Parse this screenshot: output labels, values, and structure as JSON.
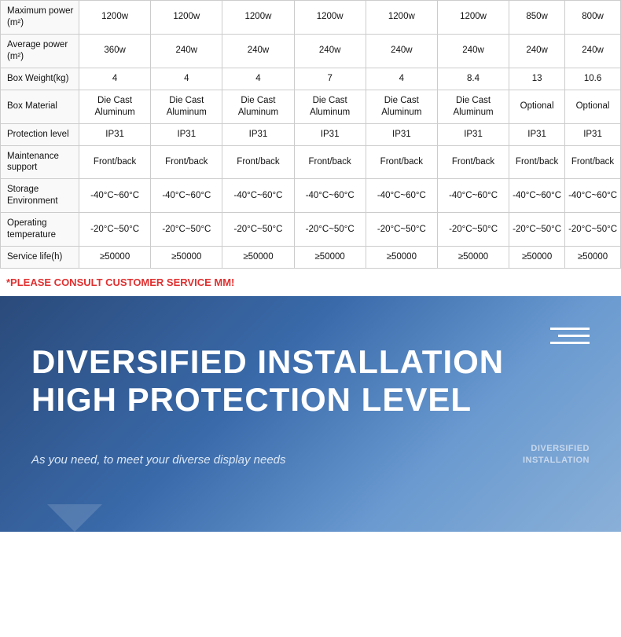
{
  "table": {
    "rows": [
      {
        "label": "Maximum power (m²)",
        "cols": [
          "1200w",
          "1200w",
          "1200w",
          "1200w",
          "1200w",
          "1200w",
          "850w",
          "800w"
        ]
      },
      {
        "label": "Average power (m²)",
        "cols": [
          "360w",
          "240w",
          "240w",
          "240w",
          "240w",
          "240w",
          "240w",
          "240w"
        ]
      },
      {
        "label": "Box Weight(kg)",
        "cols": [
          "4",
          "4",
          "4",
          "7",
          "4",
          "8.4",
          "13",
          "10.6"
        ]
      },
      {
        "label": "Box Material",
        "cols": [
          "Die Cast Aluminum",
          "Die Cast Aluminum",
          "Die Cast Aluminum",
          "Die Cast Aluminum",
          "Die Cast Aluminum",
          "Die Cast Aluminum",
          "Optional",
          "Optional"
        ]
      },
      {
        "label": "Protection level",
        "cols": [
          "IP31",
          "IP31",
          "IP31",
          "IP31",
          "IP31",
          "IP31",
          "IP31",
          "IP31"
        ]
      },
      {
        "label": "Maintenance support",
        "cols": [
          "Front/back",
          "Front/back",
          "Front/back",
          "Front/back",
          "Front/back",
          "Front/back",
          "Front/back",
          "Front/back"
        ]
      },
      {
        "label": "Storage Environment",
        "cols": [
          "-40°C~60°C",
          "-40°C~60°C",
          "-40°C~60°C",
          "-40°C~60°C",
          "-40°C~60°C",
          "-40°C~60°C",
          "-40°C~60°C",
          "-40°C~60°C"
        ]
      },
      {
        "label": "Operating temperature",
        "cols": [
          "-20°C~50°C",
          "-20°C~50°C",
          "-20°C~50°C",
          "-20°C~50°C",
          "-20°C~50°C",
          "-20°C~50°C",
          "-20°C~50°C",
          "-20°C~50°C"
        ]
      },
      {
        "label": "Service life(h)",
        "cols": [
          "≥50000",
          "≥50000",
          "≥50000",
          "≥50000",
          "≥50000",
          "≥50000",
          "≥50000",
          "≥50000"
        ]
      }
    ],
    "notice": "*PLEASE CONSULT CUSTOMER SERVICE MM!"
  },
  "banner": {
    "title_line1": "DIVERSIFIED INSTALLATION",
    "title_line2": "HIGH PROTECTION LEVEL",
    "description": "As you need, to meet your diverse display needs",
    "side_label_line1": "DIVERSIFIED",
    "side_label_line2": "INSTALLATION",
    "hamburger_line_widths": [
      50,
      40,
      50
    ]
  }
}
